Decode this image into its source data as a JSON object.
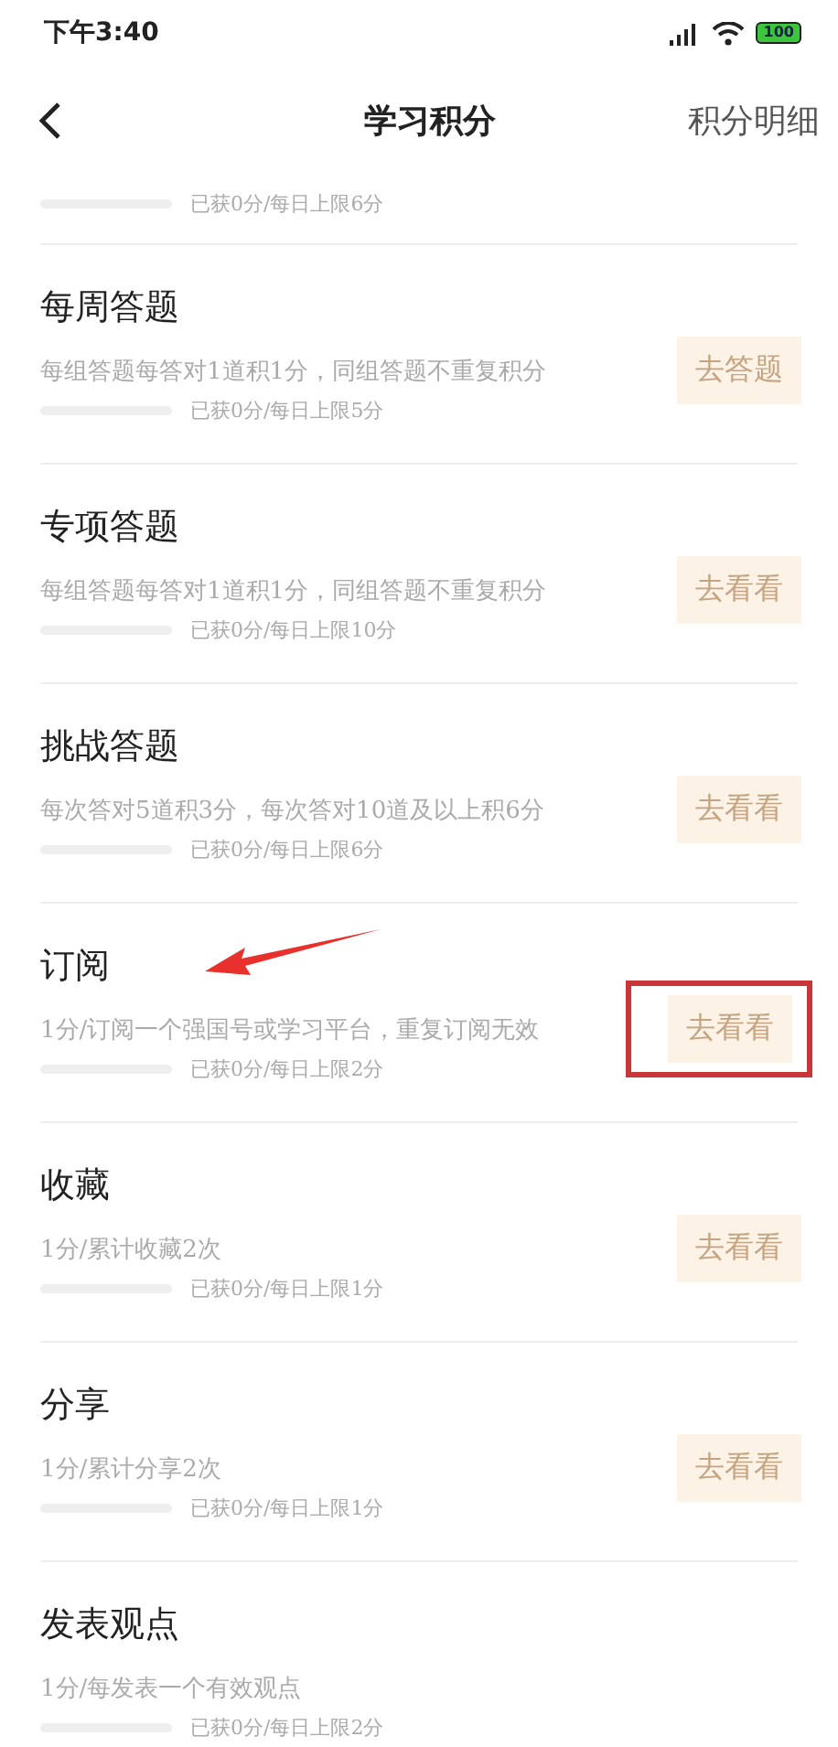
{
  "status_bar": {
    "time": "下午3:40",
    "battery": "100"
  },
  "header": {
    "title": "学习积分",
    "action": "积分明细"
  },
  "items": [
    {
      "progress_text": "已获0分/每日上限6分",
      "level": 0,
      "annotated": false
    },
    {
      "title": "每周答题",
      "description": "每组答题每答对1道积1分，同组答题不重复积分",
      "progress_text": "已获0分/每日上限5分",
      "level": 0,
      "button": "去答题",
      "annotated": false
    },
    {
      "title": "专项答题",
      "description": "每组答题每答对1道积1分，同组答题不重复积分",
      "progress_text": "已获0分/每日上限10分",
      "level": 0,
      "button": "去看看",
      "annotated": false
    },
    {
      "title": "挑战答题",
      "description": "每次答对5道积3分，每次答对10道及以上积6分",
      "progress_text": "已获0分/每日上限6分",
      "level": 0,
      "button": "去看看",
      "annotated": false
    },
    {
      "title": "订阅",
      "description": "1分/订阅一个强国号或学习平台，重复订阅无效",
      "progress_text": "已获0分/每日上限2分",
      "level": 0,
      "button": "去看看",
      "annotated": true
    },
    {
      "title": "收藏",
      "description": "1分/累计收藏2次",
      "progress_text": "已获0分/每日上限1分",
      "level": 0,
      "button": "去看看",
      "annotated": false
    },
    {
      "title": "分享",
      "description": "1分/累计分享2次",
      "progress_text": "已获0分/每日上限1分",
      "level": 0,
      "button": "去看看",
      "annotated": false
    },
    {
      "title": "发表观点",
      "description": "1分/每发表一个有效观点",
      "progress_text": "已获0分/每日上限2分",
      "level": 0,
      "annotated": false
    }
  ]
}
